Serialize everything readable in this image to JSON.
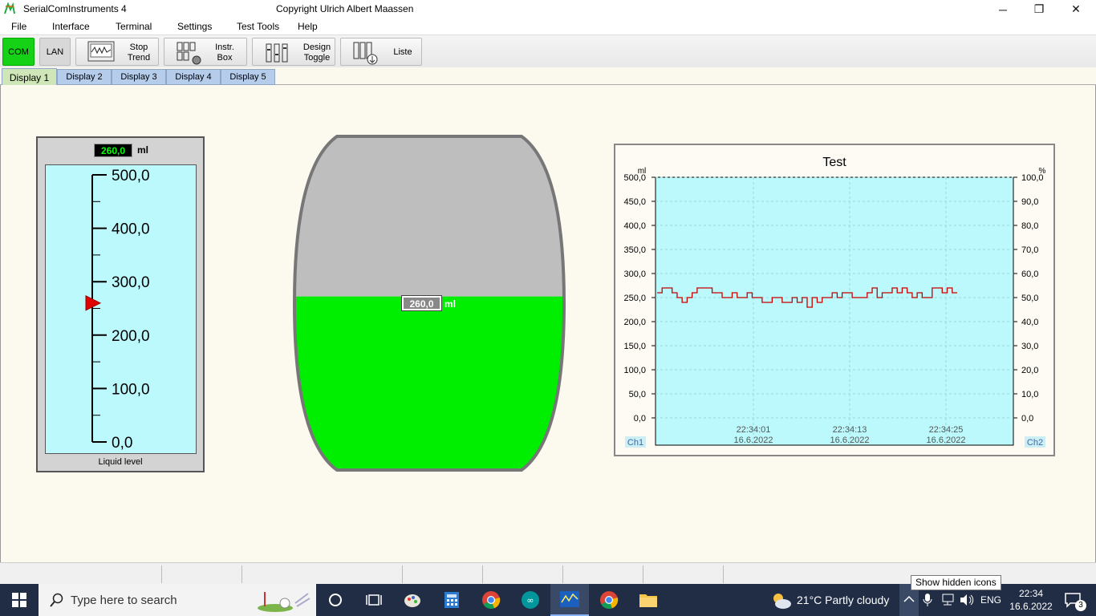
{
  "window": {
    "title": "SerialComInstruments  4",
    "copyright": "Copyright Ulrich Albert Maassen",
    "minimize": "─",
    "restore": "❐",
    "close": "✕"
  },
  "menu": [
    "File",
    "Interface",
    "Terminal",
    "Settings",
    "Test Tools",
    "Help"
  ],
  "toolbar": {
    "com": "COM",
    "lan": "LAN",
    "stop_trend": "Stop\nTrend",
    "instr_box": "Instr.\nBox",
    "design_toggle": "Design\nToggle",
    "liste": "Liste"
  },
  "tabs": [
    "Display 1",
    "Display 2",
    "Display 3",
    "Display 4",
    "Display 5"
  ],
  "gauge": {
    "value": "260,0",
    "unit": "ml",
    "caption": "Liquid level",
    "ticks": [
      "500,0",
      "400,0",
      "300,0",
      "200,0",
      "100,0",
      "0,0"
    ],
    "level": 260,
    "max": 500
  },
  "tank": {
    "value": "260,0",
    "unit": "ml",
    "fill_fraction": 0.52
  },
  "chart_data": {
    "type": "line",
    "title": "Test",
    "y_left_label": "ml",
    "y_right_label": "%",
    "y_left_ticks": [
      "500,0",
      "450,0",
      "400,0",
      "350,0",
      "300,0",
      "250,0",
      "200,0",
      "150,0",
      "100,0",
      "50,0",
      "0,0"
    ],
    "y_right_ticks": [
      "100,0",
      "90,0",
      "80,0",
      "70,0",
      "60,0",
      "50,0",
      "40,0",
      "30,0",
      "20,0",
      "10,0",
      "0,0"
    ],
    "ylim": [
      0,
      500
    ],
    "x_ticks": [
      {
        "time": "22:34:01",
        "date": "16.6.2022"
      },
      {
        "time": "22:34:13",
        "date": "16.6.2022"
      },
      {
        "time": "22:34:25",
        "date": "16.6.2022"
      }
    ],
    "ch1_label": "Ch1",
    "ch2_label": "Ch2",
    "grid": true,
    "series": [
      {
        "color": "#c80000",
        "values": [
          260,
          270,
          270,
          260,
          250,
          240,
          250,
          260,
          270,
          270,
          270,
          260,
          260,
          250,
          250,
          260,
          250,
          250,
          260,
          250,
          250,
          240,
          240,
          250,
          250,
          240,
          240,
          250,
          240,
          250,
          230,
          250,
          240,
          250,
          250,
          260,
          250,
          260,
          260,
          250,
          250,
          250,
          260,
          270,
          250,
          260,
          260,
          270,
          260,
          270,
          260,
          250,
          260,
          250,
          250,
          270,
          270,
          260,
          270,
          260
        ]
      }
    ],
    "grid_color": "#9cd8d8",
    "plot_bg": "#bbf9fd"
  },
  "statusbar": {
    "tooltip": "Show hidden icons"
  },
  "taskbar": {
    "search_placeholder": "Type here to search",
    "weather": "21°C  Partly cloudy",
    "lang": "ENG",
    "time": "22:34",
    "date": "16.6.2022",
    "notifications": "3"
  }
}
